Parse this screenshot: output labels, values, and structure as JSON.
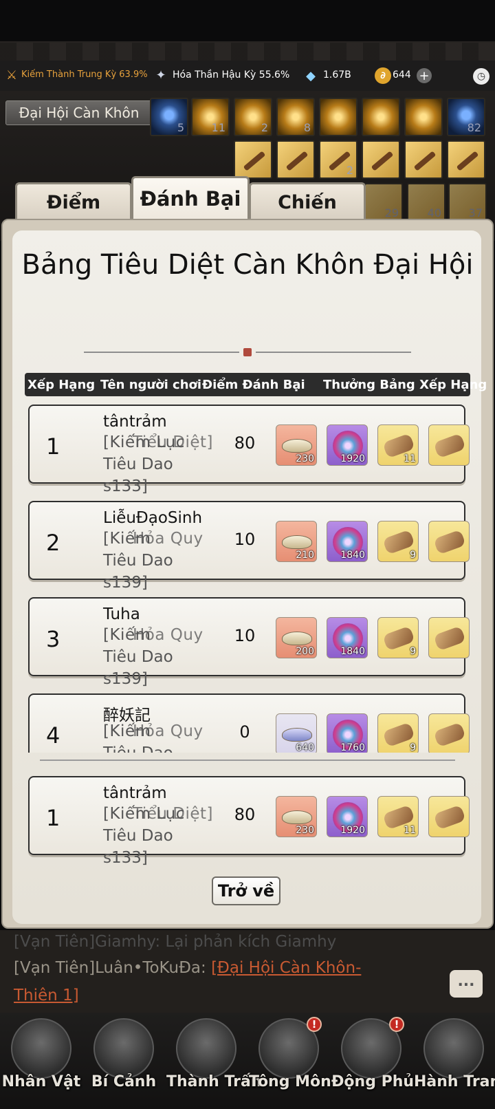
{
  "status": {
    "cultivation_1": "Kiếm Thành Trung Kỳ 63.9%",
    "cultivation_2": "Hóa Thần Hậu Kỳ 55.6%",
    "spirit_stones": "1.67B",
    "coins": "644"
  },
  "event_name": "Đại Hội Càn Khôn",
  "skill_slots": [
    "5",
    "11",
    "2",
    "8",
    "",
    "",
    "",
    "82"
  ],
  "weapon_slots": [
    "",
    "",
    "2",
    "",
    "",
    ""
  ],
  "weapon_slots_2": [
    "29",
    "40",
    "37"
  ],
  "tabs": [
    "Điểm",
    "Đánh Bại",
    "Chiến Lược"
  ],
  "active_tab": "Đánh Bại",
  "board_title": "Bảng Tiêu Diệt Càn Khôn Đại Hội",
  "table_headers": {
    "rank": "Xếp Hạng",
    "player": "Tên người chơi",
    "points": "Điểm Đánh Bại",
    "reward": "Thưởng Bảng Xếp Hạng"
  },
  "rows": [
    {
      "rank": "1",
      "name": "tântrảm",
      "guild": "[Kiếm Lục",
      "guild_overlap": "Tiểu Diệt]",
      "line2": "Tiêu Dao",
      "line3": "s133]",
      "points": "80",
      "rewards": [
        "230",
        "1920",
        "11",
        ""
      ]
    },
    {
      "rank": "2",
      "name": "LiễuĐạoSinh",
      "guild": "[Kiếm",
      "guild_overlap": "Hỏa Quy",
      "line2": "Tiêu Dao",
      "line3": "s139]",
      "points": "10",
      "rewards": [
        "210",
        "1840",
        "9",
        ""
      ]
    },
    {
      "rank": "3",
      "name": "Tuha",
      "guild": "[Kiếm",
      "guild_overlap": "Hỏa Quy",
      "line2": "Tiêu Dao",
      "line3": "s139]",
      "points": "10",
      "rewards": [
        "200",
        "1840",
        "9",
        ""
      ]
    },
    {
      "rank": "4",
      "name": "醉妖記",
      "guild": "[Kiếm",
      "guild_overlap": "Hỏa Quy",
      "line2": "Tiêu Dao",
      "line3": "",
      "points": "0",
      "rewards": [
        "640",
        "1760",
        "9",
        ""
      ]
    }
  ],
  "my_row": {
    "rank": "1",
    "name": "tântrảm",
    "guild": "[Kiếm Lục",
    "guild_overlap": "Tiểu Diệt]",
    "line2": "Tiêu Dao",
    "line3": "s133]",
    "points": "80",
    "rewards": [
      "230",
      "1920",
      "11",
      ""
    ]
  },
  "back_button": "Trở về",
  "chat": {
    "line1": "[Vạn Tiên]Giamhy: Lại phản kích Giamhy",
    "line2_speaker": "[Vạn Tiên]Luân•ToKuĐa:",
    "line2_link": "[Đại Hội Càn Khôn-",
    "line3_link": "Thiên 1]",
    "button": "..."
  },
  "nav": [
    {
      "label": "Nhân Vật",
      "badge": ""
    },
    {
      "label": "Bí Cảnh",
      "badge": ""
    },
    {
      "label": "Thành Trấn",
      "badge": ""
    },
    {
      "label": "Tông Môn",
      "badge": "!"
    },
    {
      "label": "Động Phủ",
      "badge": "!"
    },
    {
      "label": "Hành Trang",
      "badge": ""
    }
  ],
  "colors": {
    "cultivation_1": "#e8a23c",
    "cultivation_2": "#ffffff",
    "chat_link": "#c95a32"
  }
}
